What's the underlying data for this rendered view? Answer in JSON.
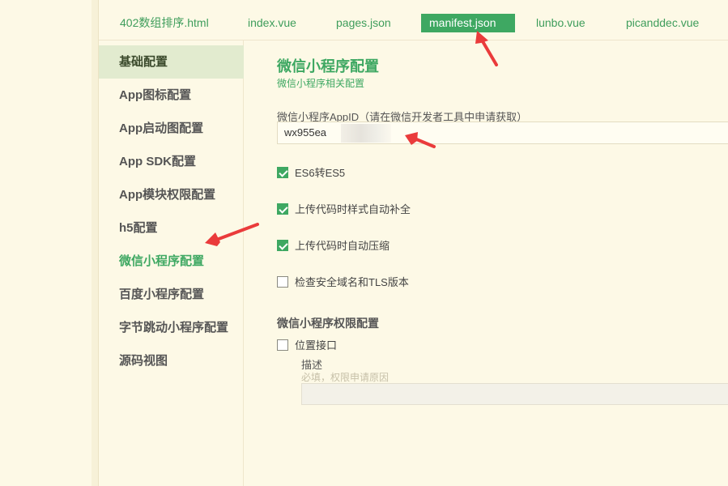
{
  "tabs": [
    {
      "label": "402数组排序.html",
      "active": false
    },
    {
      "label": "index.vue",
      "active": false
    },
    {
      "label": "pages.json",
      "active": false
    },
    {
      "label": "manifest.json",
      "active": true
    },
    {
      "label": "lunbo.vue",
      "active": false
    },
    {
      "label": "picanddec.vue",
      "active": false
    }
  ],
  "sidebar": {
    "items": [
      {
        "label": "基础配置",
        "state": "selected"
      },
      {
        "label": "App图标配置"
      },
      {
        "label": "App启动图配置"
      },
      {
        "label": "App SDK配置"
      },
      {
        "label": "App模块权限配置"
      },
      {
        "label": "h5配置"
      },
      {
        "label": "微信小程序配置",
        "state": "highlighted"
      },
      {
        "label": "百度小程序配置"
      },
      {
        "label": "字节跳动小程序配置"
      },
      {
        "label": "源码视图"
      }
    ]
  },
  "main": {
    "title": "微信小程序配置",
    "subtitle": "微信小程序相关配置",
    "appid_label": "微信小程序AppID（请在微信开发者工具中申请获取）",
    "appid_value": "wx955ea",
    "options": [
      {
        "label": "ES6转ES5",
        "checked": true
      },
      {
        "label": "上传代码时样式自动补全",
        "checked": true
      },
      {
        "label": "上传代码时自动压缩",
        "checked": true
      },
      {
        "label": "检查安全域名和TLS版本",
        "checked": false
      }
    ],
    "permissions_title": "微信小程序权限配置",
    "location": {
      "label": "位置接口",
      "checked": false,
      "desc_label": "描述",
      "desc_placeholder": "必填，权限申请原因"
    }
  },
  "colors": {
    "accent": "#3ea862",
    "background": "#fdf9e6",
    "selected_bg": "#e2ebcf",
    "annotation": "#ea3b3b"
  }
}
